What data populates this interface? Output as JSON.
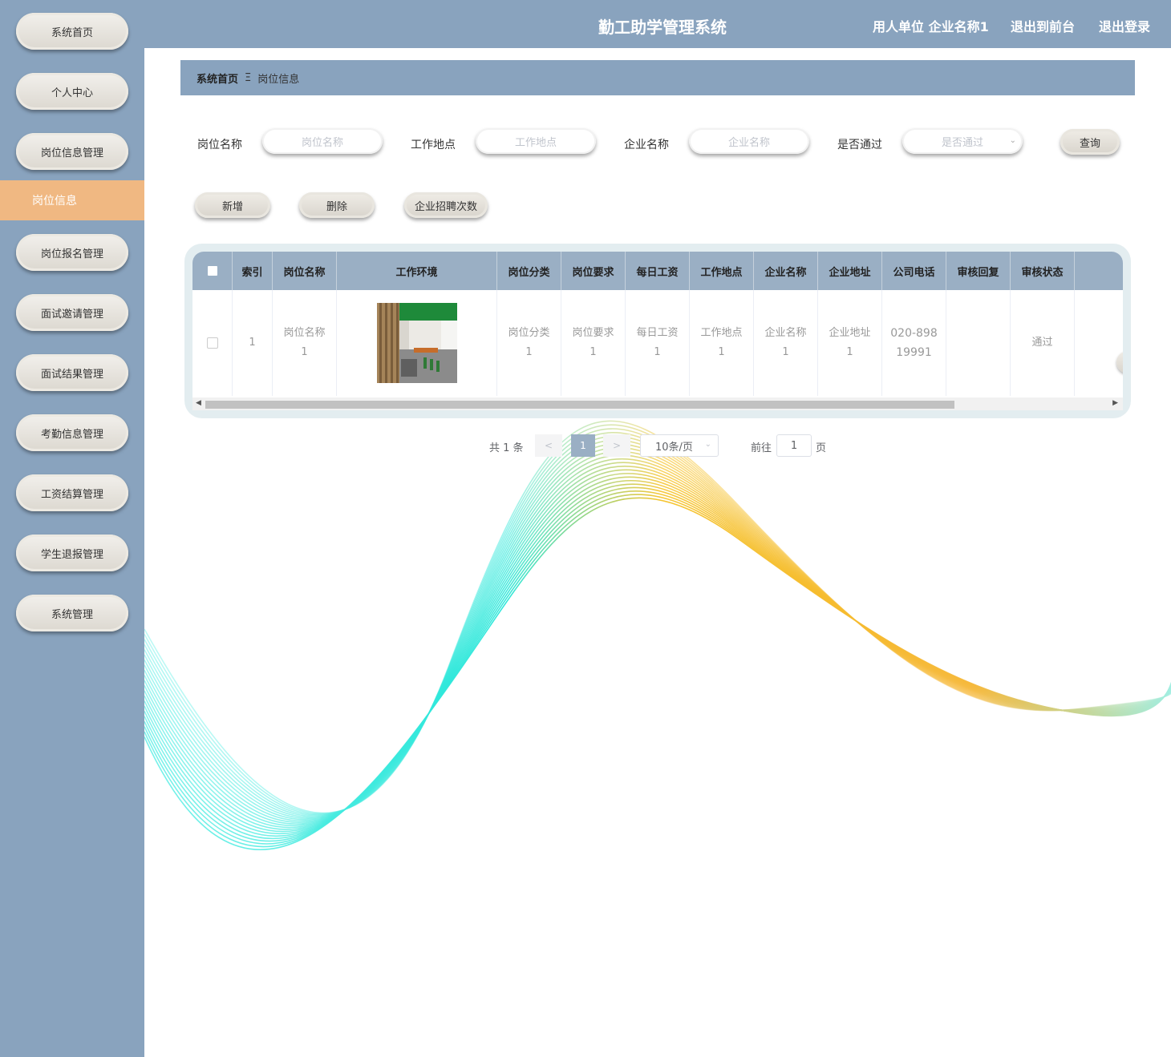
{
  "header": {
    "title": "勤工助学管理系统",
    "user_info": "用人单位 企业名称1",
    "to_front": "退出到前台",
    "logout": "退出登录"
  },
  "sidebar": {
    "items": [
      {
        "label": "系统首页"
      },
      {
        "label": "个人中心"
      },
      {
        "label": "岗位信息管理"
      },
      {
        "label": "岗位报名管理"
      },
      {
        "label": "面试邀请管理"
      },
      {
        "label": "面试结果管理"
      },
      {
        "label": "考勤信息管理"
      },
      {
        "label": "工资结算管理"
      },
      {
        "label": "学生退报管理"
      },
      {
        "label": "系统管理"
      }
    ],
    "active_sub": "岗位信息"
  },
  "breadcrumb": {
    "home": "系统首页",
    "separator": "Ξ",
    "current": "岗位信息"
  },
  "search": {
    "job_name_label": "岗位名称",
    "job_name_placeholder": "岗位名称",
    "location_label": "工作地点",
    "location_placeholder": "工作地点",
    "company_label": "企业名称",
    "company_placeholder": "企业名称",
    "approved_label": "是否通过",
    "approved_placeholder": "是否通过",
    "query_button": "查询"
  },
  "actions": {
    "add": "新增",
    "delete": "删除",
    "recruit_count": "企业招聘次数"
  },
  "table": {
    "columns": [
      "索引",
      "岗位名称",
      "工作环境",
      "岗位分类",
      "岗位要求",
      "每日工资",
      "工作地点",
      "企业名称",
      "企业地址",
      "公司电话",
      "审核回复",
      "审核状态"
    ],
    "rows": [
      {
        "index": "1",
        "job_name": [
          "岗位名称",
          "1"
        ],
        "job_category": [
          "岗位分类",
          "1"
        ],
        "job_requirement": [
          "岗位要求",
          "1"
        ],
        "daily_wage": [
          "每日工资",
          "1"
        ],
        "location": [
          "工作地点",
          "1"
        ],
        "company": [
          "企业名称",
          "1"
        ],
        "address": [
          "企业地址",
          "1"
        ],
        "phone": [
          "020-898",
          "19991"
        ],
        "reply": "",
        "status": "通过"
      }
    ]
  },
  "pagination": {
    "total": "共 1 条",
    "prev": "<",
    "current": "1",
    "next": ">",
    "page_size": "10条/页",
    "goto_label": "前往",
    "goto_value": "1",
    "page_suffix": "页"
  },
  "colors": {
    "sidebar_bg": "#89a3be",
    "active_item": "#f0b882",
    "table_header": "#9aafc4"
  }
}
